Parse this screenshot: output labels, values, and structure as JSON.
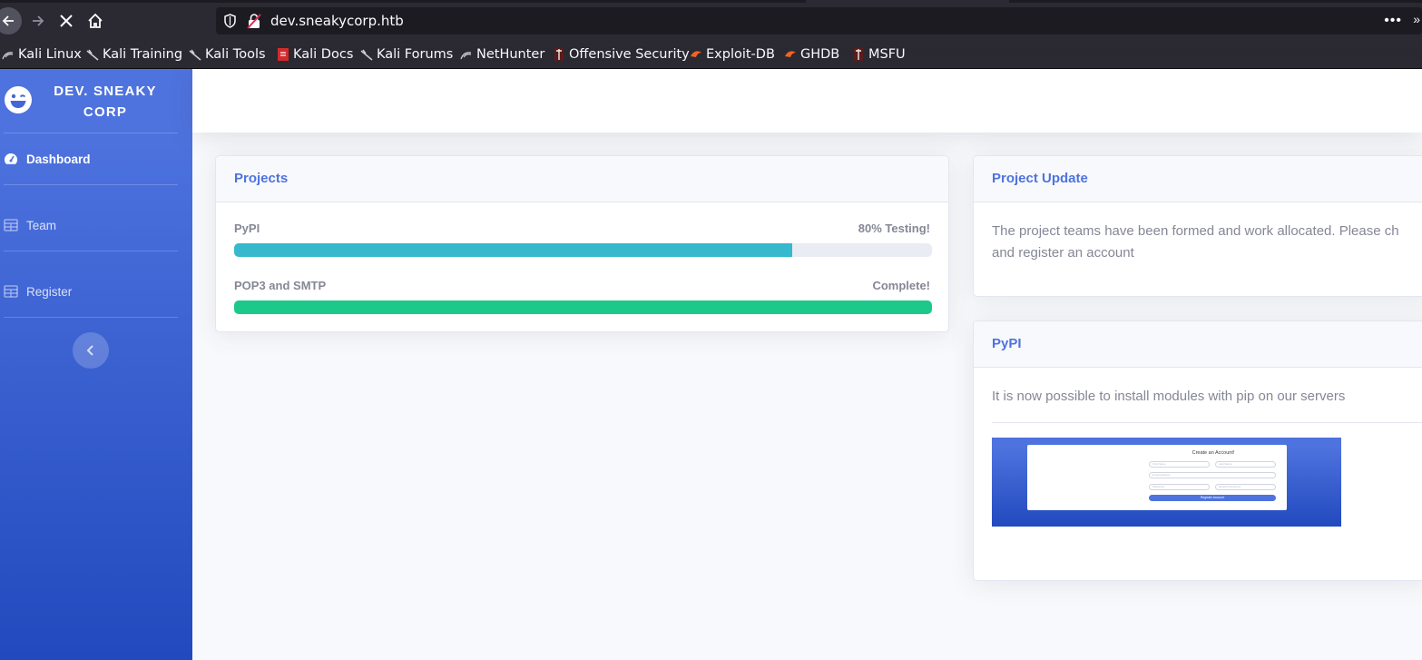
{
  "browser": {
    "url": "dev.sneakycorp.htb",
    "menu_glyph": "•••",
    "overflow_glyph": "»",
    "bookmarks": [
      {
        "label": "Kali Linux",
        "icon": "kali-dragon-icon"
      },
      {
        "label": "Kali Training",
        "icon": "kali-dragon-icon"
      },
      {
        "label": "Kali Tools",
        "icon": "kali-dragon-icon"
      },
      {
        "label": "Kali Docs",
        "icon": "kali-docs-icon"
      },
      {
        "label": "Kali Forums",
        "icon": "kali-dragon-icon"
      },
      {
        "label": "NetHunter",
        "icon": "kali-dragon-icon"
      },
      {
        "label": "Offensive Security",
        "icon": "offsec-icon"
      },
      {
        "label": "Exploit-DB",
        "icon": "exploitdb-icon"
      },
      {
        "label": "GHDB",
        "icon": "exploitdb-icon"
      },
      {
        "label": "MSFU",
        "icon": "offsec-icon"
      }
    ]
  },
  "sidebar": {
    "brand": "DEV. SNEAKY CORP",
    "brand_icon": "laugh-wink-icon",
    "items": [
      {
        "label": "Dashboard",
        "icon": "tachometer-icon",
        "active": true
      },
      {
        "label": "Team",
        "icon": "table-icon",
        "active": false
      },
      {
        "label": "Register",
        "icon": "table-icon",
        "active": false
      }
    ],
    "toggle_glyph": "‹"
  },
  "projects": {
    "title": "Projects",
    "items": [
      {
        "name": "PyPI",
        "status": "80% Testing!",
        "progress": 0.8,
        "color": "#36b9cc"
      },
      {
        "name": "POP3 and SMTP",
        "status": "Complete!",
        "progress": 1.0,
        "color": "#1cc88a"
      }
    ]
  },
  "project_update": {
    "title": "Project Update",
    "line1": "The project teams have been formed and work allocated. Please ch",
    "line2": "and register an account"
  },
  "pypi": {
    "title": "PyPI",
    "text": "It is now possible to install modules with pip on our servers",
    "screenshot": {
      "title": "Create an Account!",
      "first_name": "First Name",
      "last_name": "Last Name",
      "email": "Email Address",
      "password": "Password",
      "repeat_password": "Repeat Password",
      "button": "Register Account"
    }
  },
  "colors": {
    "primary": "#4e73df",
    "info": "#36b9cc",
    "success": "#1cc88a",
    "text_muted": "#858796"
  }
}
